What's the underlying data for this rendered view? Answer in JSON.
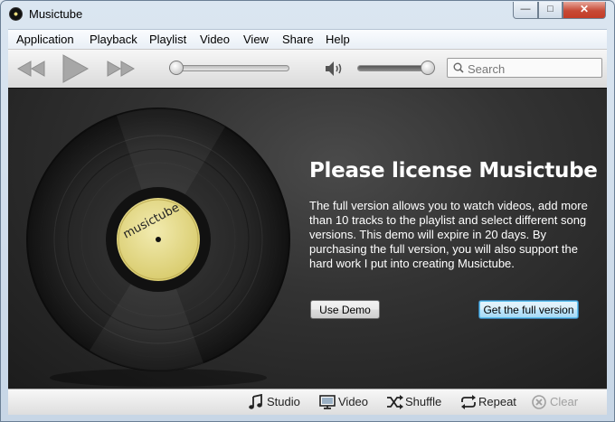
{
  "window": {
    "title": "Musictube",
    "controls": {
      "minimize": "—",
      "maximize": "□",
      "close": "✕"
    }
  },
  "menu": [
    "Application",
    "Playback",
    "Playlist",
    "Video",
    "View",
    "Share",
    "Help"
  ],
  "toolbar": {
    "icons": [
      "rewind-icon",
      "play-icon",
      "fast-forward-icon",
      "speaker-icon",
      "search-icon"
    ],
    "seek_position": 0.0,
    "volume_level": 1.0,
    "search_placeholder": "Search"
  },
  "license": {
    "record_label": "musictube",
    "headline": "Please license Musictube",
    "body": "The full version allows you to watch videos, add more than 10 tracks to the playlist and select different song versions. This demo will expire in 20 days. By purchasing the full version, you will also support the hard work I put into creating Musictube.",
    "use_demo_button": "Use Demo",
    "full_version_button": "Get the full version"
  },
  "bottom_bar": {
    "studio": "Studio",
    "video": "Video",
    "shuffle": "Shuffle",
    "repeat": "Repeat",
    "clear": "Clear"
  },
  "colors": {
    "accent_blue": "#3c7fb1",
    "close_red": "#c74a36",
    "label_yellow": "#e6dc8c",
    "panel_dark": "#2a2a2a"
  }
}
